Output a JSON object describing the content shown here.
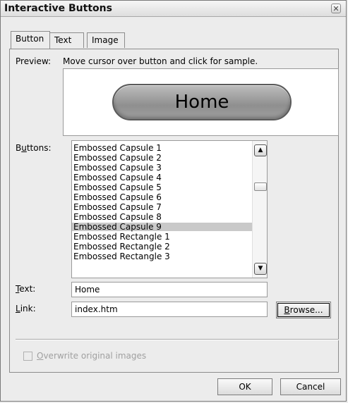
{
  "dialog": {
    "title": "Interactive Buttons",
    "close_glyph": "✕"
  },
  "tabs": [
    {
      "label": "Button",
      "active": true
    },
    {
      "label": "Text",
      "active": false
    },
    {
      "label": "Image",
      "active": false
    }
  ],
  "preview": {
    "label": "Preview:",
    "hint": "Move cursor over button and click for sample.",
    "button_text": "Home"
  },
  "buttons_list": {
    "label_prefix": "B",
    "label_underlined": "u",
    "label_suffix": "ttons:",
    "items": [
      "Embossed Capsule 1",
      "Embossed Capsule 2",
      "Embossed Capsule 3",
      "Embossed Capsule 4",
      "Embossed Capsule 5",
      "Embossed Capsule 6",
      "Embossed Capsule 7",
      "Embossed Capsule 8",
      "Embossed Capsule 9",
      "Embossed Rectangle 1",
      "Embossed Rectangle 2",
      "Embossed Rectangle 3"
    ],
    "selected": "Embossed Capsule 9",
    "scroll_up_glyph": "▲",
    "scroll_down_glyph": "▼"
  },
  "text_field": {
    "label_underlined": "T",
    "label_suffix": "ext:",
    "value": "Home"
  },
  "link_field": {
    "label_underlined": "L",
    "label_suffix": "ink:",
    "value": "index.htm",
    "browse_underlined": "B",
    "browse_suffix": "rowse..."
  },
  "overwrite": {
    "label_underlined": "O",
    "label_suffix": "verwrite original images",
    "checked": false,
    "enabled": false
  },
  "footer": {
    "ok_label": "OK",
    "cancel_label": "Cancel"
  }
}
